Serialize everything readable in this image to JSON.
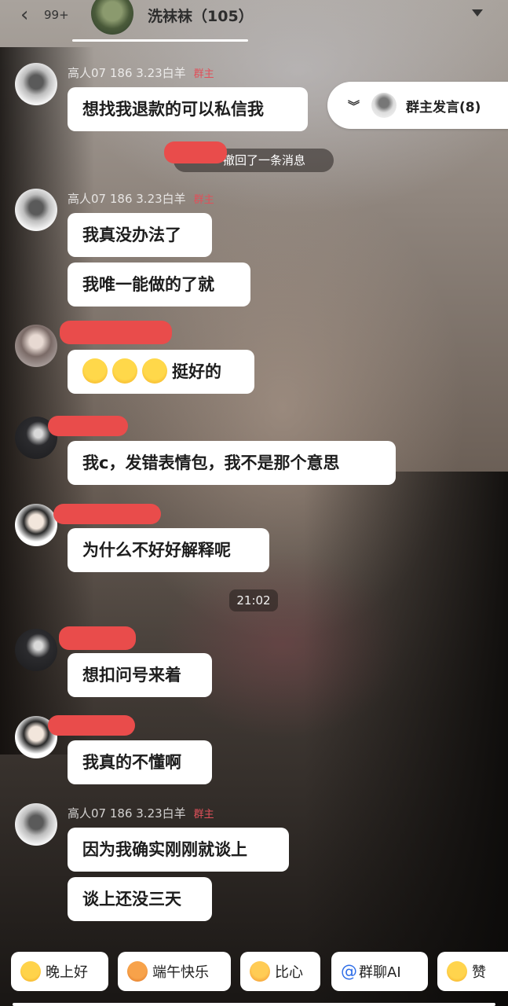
{
  "header": {
    "back_count": "99+",
    "title": "洗袜袜（105）"
  },
  "host_pill": {
    "label": "群主发言(8)"
  },
  "system": {
    "recall_text": "撤回了一条消息",
    "time": "21:02"
  },
  "host": {
    "name": "高人07  186  3.23白羊",
    "badge": "群主"
  },
  "messages": [
    {
      "text": "想找我退款的可以私信我"
    },
    {
      "text": "我真没办法了"
    },
    {
      "text": "我唯一能做的了就"
    },
    {
      "text": "挺好的"
    },
    {
      "text": "我c，发错表情包，我不是那个意思"
    },
    {
      "text": "为什么不好好解释呢"
    },
    {
      "text": "想扣问号来着"
    },
    {
      "text": "我真的不懂啊"
    },
    {
      "text": "因为我确实刚刚就谈上"
    },
    {
      "text": "谈上还没三天"
    }
  ],
  "quick_bar": [
    {
      "label": "晚上好",
      "icon": "star-emoji-icon"
    },
    {
      "label": "端午快乐",
      "icon": "tiger-emoji-icon"
    },
    {
      "label": "比心",
      "icon": "heart-hands-emoji-icon"
    },
    {
      "label": "群聊AI",
      "icon": "at-icon",
      "glyph": "@"
    },
    {
      "label": "赞",
      "icon": "thumbs-up-emoji-icon"
    }
  ]
}
